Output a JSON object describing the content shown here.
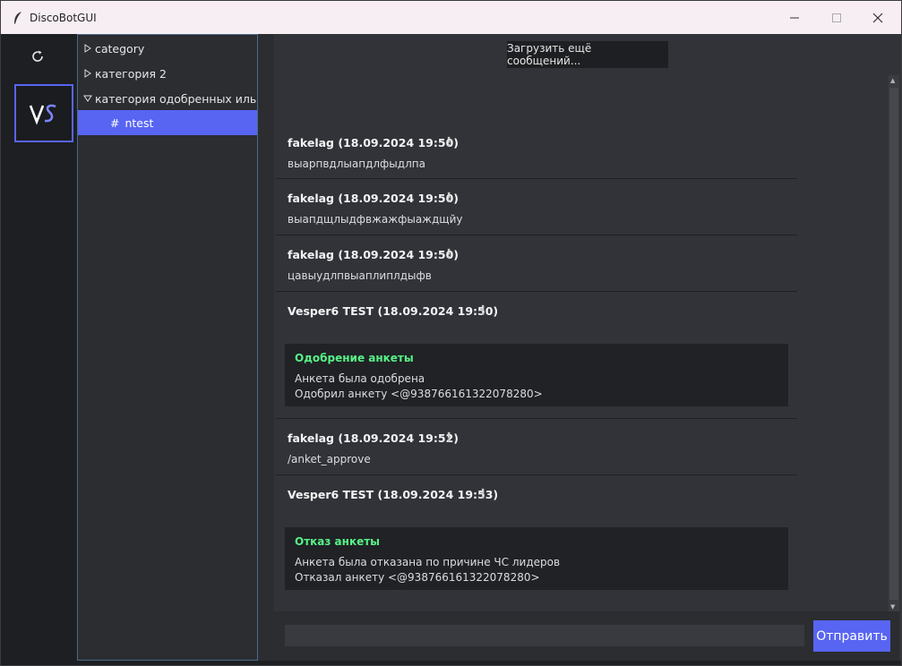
{
  "window": {
    "title": "DiscoBotGUI"
  },
  "channels": {
    "categories": [
      {
        "label": "category",
        "expanded": false
      },
      {
        "label": "категория 2",
        "expanded": false
      },
      {
        "label": "категория одобренных иль нет",
        "expanded": true
      }
    ],
    "active_channel": {
      "hash": "#",
      "name": "ntest"
    }
  },
  "chat": {
    "load_more": "Загрузить ещё сообщений...",
    "messages": [
      {
        "author": "fakelag (18.09.2024 19:50)",
        "text": "выарпвдлыапдлфыдлпа"
      },
      {
        "author": "fakelag (18.09.2024 19:50)",
        "text": "выапдщлыдфвжажфыаждщйу"
      },
      {
        "author": "fakelag (18.09.2024 19:50)",
        "text": "цавыудлпвыаплиплдыфв"
      },
      {
        "author": "Vesper6 TEST (18.09.2024 19:50)",
        "embed": {
          "title": "Одобрение анкеты",
          "lines": [
            "Анкета была одобрена",
            "Одобрил анкету <@938766161322078280>"
          ]
        }
      },
      {
        "author": "fakelag (18.09.2024 19:52)",
        "text": "/anket_approve"
      },
      {
        "author": "Vesper6 TEST (18.09.2024 19:53)",
        "embed": {
          "title": "Отказ анкеты",
          "lines": [
            "Анкета была отказана по причине ЧС лидеров",
            "Отказал анкету <@938766161322078280>"
          ]
        }
      }
    ]
  },
  "composer": {
    "input_value": "",
    "send_label": "Отправить"
  },
  "colors": {
    "accent": "#5865f2",
    "embed_title": "#57f287"
  }
}
